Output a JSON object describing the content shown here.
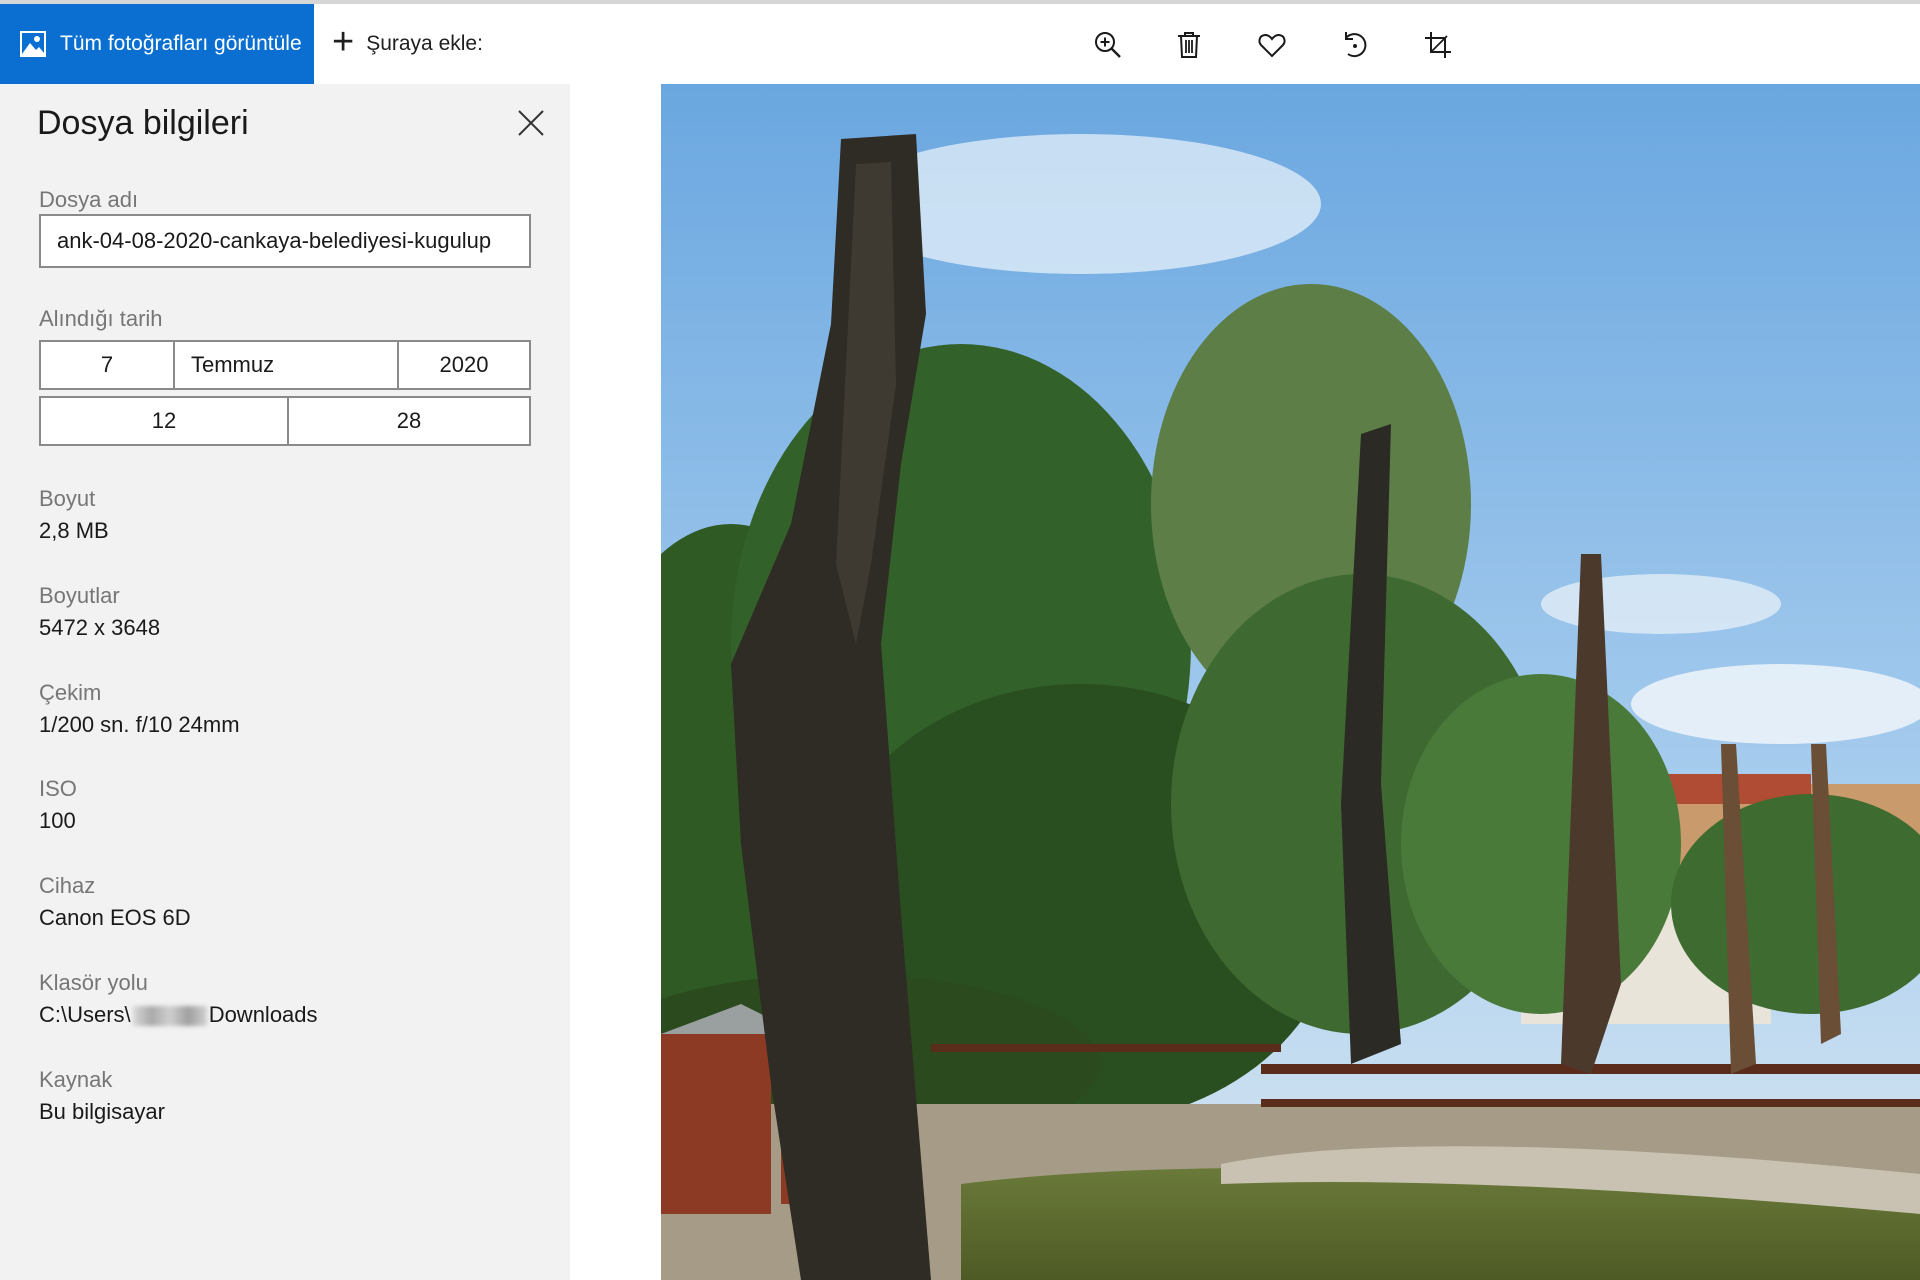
{
  "toolbar": {
    "view_all_label": "Tüm fotoğrafları görüntüle",
    "add_to_label": "Şuraya ekle:",
    "tools": [
      "zoom-in-icon",
      "delete-icon",
      "favorite-icon",
      "rotate-icon",
      "crop-icon"
    ]
  },
  "info_panel": {
    "title": "Dosya bilgileri",
    "filename_label": "Dosya adı",
    "filename_value": "ank-04-08-2020-cankaya-belediyesi-kugulup",
    "date_label": "Alındığı tarih",
    "date": {
      "day": "7",
      "month": "Temmuz",
      "year": "2020"
    },
    "time": {
      "hour": "12",
      "minute": "28"
    },
    "size_label": "Boyut",
    "size_value": "2,8 MB",
    "dimensions_label": "Boyutlar",
    "dimensions_value": "5472 x 3648",
    "shot_label": "Çekim",
    "shot_value": "1/200 sn. f/10 24mm",
    "iso_label": "ISO",
    "iso_value": "100",
    "device_label": "Cihaz",
    "device_value": "Canon EOS 6D",
    "folder_label": "Klasör yolu",
    "folder_prefix": "C:\\Users\\",
    "folder_suffix": "Downloads",
    "source_label": "Kaynak",
    "source_value": "Bu bilgisayar"
  },
  "colors": {
    "accent": "#0a6fd0",
    "panel_bg": "#f2f2f2"
  }
}
